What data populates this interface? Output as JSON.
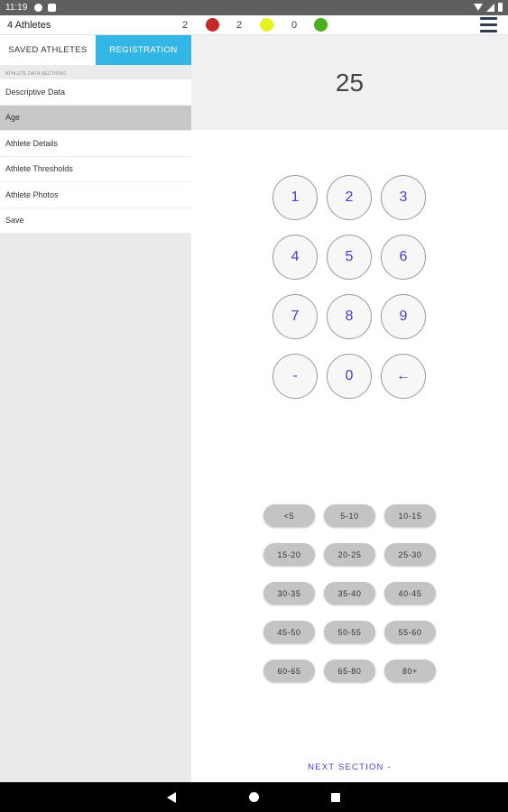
{
  "status_bar": {
    "time": "11:19",
    "icons": [
      "notification-icon",
      "sim-icon",
      "wifi-icon",
      "signal-icon",
      "battery-icon"
    ]
  },
  "header": {
    "athlete_count": "4 Athletes",
    "stats": [
      {
        "value": "2",
        "status_color": "#c62828"
      },
      {
        "value": "2",
        "status_color": "#e8f020"
      },
      {
        "value": "0",
        "status_color": "#4caf20"
      }
    ],
    "menu_icon": "hamburger-menu-icon"
  },
  "sidebar": {
    "tabs": [
      {
        "label": "SAVED ATHLETES",
        "active": false
      },
      {
        "label": "REGISTRATION",
        "active": true
      }
    ],
    "section_caption": "ATHLETE DATA SECTIONS",
    "items": [
      {
        "label": "Descriptive Data",
        "selected": false
      },
      {
        "label": "Age",
        "selected": true
      },
      {
        "label": "Athlete Details",
        "selected": false
      },
      {
        "label": "Athlete Thresholds",
        "selected": false
      },
      {
        "label": "Athlete Photos",
        "selected": false
      },
      {
        "label": "Save",
        "selected": false
      }
    ]
  },
  "main": {
    "value": "25",
    "keypad": [
      "1",
      "2",
      "3",
      "4",
      "5",
      "6",
      "7",
      "8",
      "9",
      "-",
      "0",
      "←"
    ],
    "age_ranges": [
      "<5",
      "5-10",
      "10-15",
      "15-20",
      "20-25",
      "25-30",
      "30-35",
      "35-40",
      "40-45",
      "45-50",
      "50-55",
      "55-60",
      "60-65",
      "65-80",
      "80+"
    ],
    "next_label": "NEXT SECTION -"
  },
  "colors": {
    "accent": "#33b5e5",
    "key_text": "#4b3bd3"
  },
  "nav_bar": {
    "icons": [
      "back-icon",
      "home-icon",
      "recents-icon"
    ]
  }
}
